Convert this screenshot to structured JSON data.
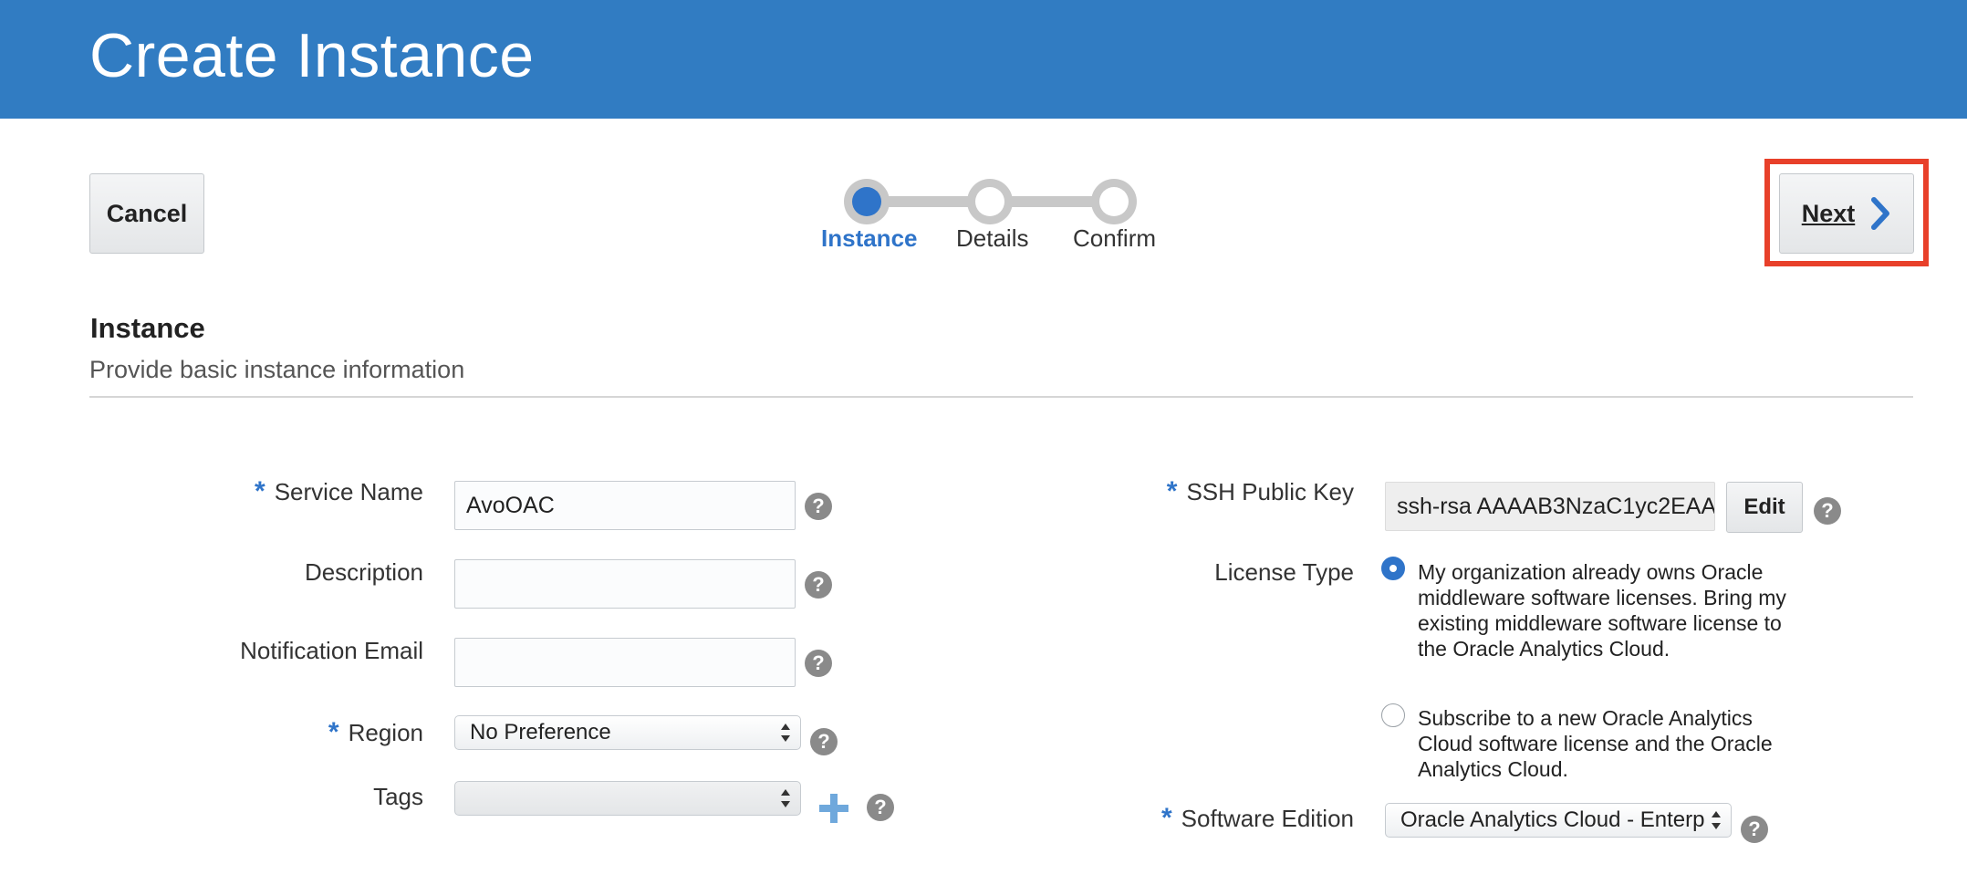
{
  "header": {
    "title": "Create Instance"
  },
  "buttons": {
    "cancel": "Cancel",
    "next": "Next"
  },
  "train": {
    "steps": [
      {
        "label": "Instance",
        "active": true
      },
      {
        "label": "Details",
        "active": false
      },
      {
        "label": "Confirm",
        "active": false
      }
    ]
  },
  "section": {
    "title": "Instance",
    "subtitle": "Provide basic instance information"
  },
  "form_left": {
    "service_name": {
      "label": "Service Name",
      "required": true,
      "value": "AvoOAC"
    },
    "description": {
      "label": "Description",
      "required": false,
      "value": ""
    },
    "notification_email": {
      "label": "Notification Email",
      "required": false,
      "value": ""
    },
    "region": {
      "label": "Region",
      "required": true,
      "value": "No Preference"
    },
    "tags": {
      "label": "Tags",
      "required": false,
      "value": ""
    }
  },
  "form_right": {
    "ssh_public_key": {
      "label": "SSH Public Key",
      "required": true,
      "value": "ssh-rsa AAAAB3NzaC1yc2EAA",
      "edit_label": "Edit"
    },
    "license_type": {
      "label": "License Type",
      "options": [
        {
          "text": "My organization already owns Oracle middleware software licenses. Bring my existing middleware software license to the Oracle Analytics Cloud.",
          "checked": true
        },
        {
          "text": "Subscribe to a new Oracle Analytics Cloud software license and the Oracle Analytics Cloud.",
          "checked": false
        }
      ]
    },
    "software_edition": {
      "label": "Software Edition",
      "required": true,
      "value": "Oracle Analytics Cloud - Enterp"
    }
  },
  "icons": {
    "help": "?",
    "help_name": "help-icon",
    "add": "plus-icon",
    "next_arrow": "chevron-right-icon"
  },
  "colors": {
    "header": "#317cc2",
    "accent": "#2f74c9",
    "highlight": "#e8402a"
  }
}
